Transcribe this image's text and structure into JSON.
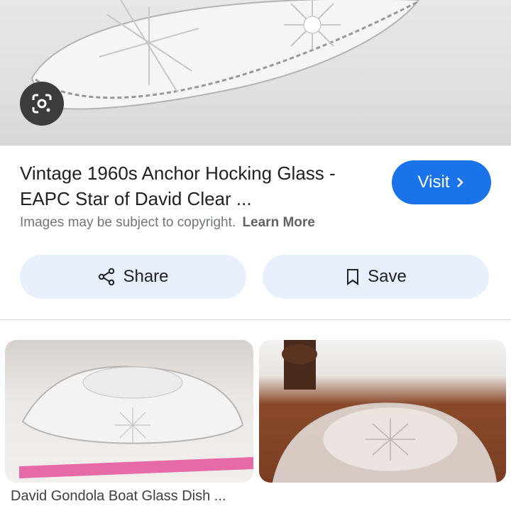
{
  "listing": {
    "title_line1": "Vintage 1960s Anchor Hocking Glass -",
    "title_line2": "EAPC Star of David Clear ...",
    "visit_label": "Visit",
    "copyright_text": "Images may be subject to copyright.",
    "learn_more_label": "Learn More"
  },
  "actions": {
    "share_label": "Share",
    "save_label": "Save"
  },
  "related": [
    {
      "caption": "David Gondola Boat Glass Dish ..."
    },
    {
      "caption": ""
    }
  ],
  "icons": [
    "lens-icon",
    "chevron-right-icon",
    "share-icon",
    "bookmark-icon"
  ],
  "colors": {
    "accent": "#1a73e8",
    "button_bg": "#e8f0fe",
    "text": "#202124",
    "muted": "#70757a"
  }
}
